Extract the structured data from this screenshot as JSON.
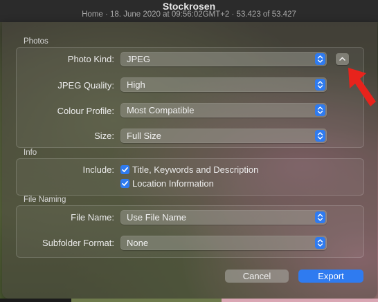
{
  "photo_header": {
    "title": "Stockrosen",
    "subtitle": "Home · 18. June 2020 at 09:56:02GMT+2 · 53.423 of 53.427"
  },
  "sections": {
    "photos": {
      "label": "Photos",
      "photo_kind_label": "Photo Kind:",
      "photo_kind_value": "JPEG",
      "jpeg_quality_label": "JPEG Quality:",
      "jpeg_quality_value": "High",
      "colour_profile_label": "Colour Profile:",
      "colour_profile_value": "Most Compatible",
      "size_label": "Size:",
      "size_value": "Full Size"
    },
    "info": {
      "label": "Info",
      "include_label": "Include:",
      "options": [
        {
          "label": "Title, Keywords and Description",
          "checked": true
        },
        {
          "label": "Location Information",
          "checked": true
        }
      ]
    },
    "file_naming": {
      "label": "File Naming",
      "file_name_label": "File Name:",
      "file_name_value": "Use File Name",
      "subfolder_label": "Subfolder Format:",
      "subfolder_value": "None"
    }
  },
  "buttons": {
    "cancel": "Cancel",
    "export": "Export"
  },
  "colors": {
    "accent": "#2f7bf0",
    "annotation_arrow": "#e8231c"
  },
  "icons": {
    "stepper": "chevron-up-down-icon",
    "disclosure": "chevron-up-icon",
    "checkbox": "checkmark-icon",
    "annotation": "red-arrow-icon"
  }
}
